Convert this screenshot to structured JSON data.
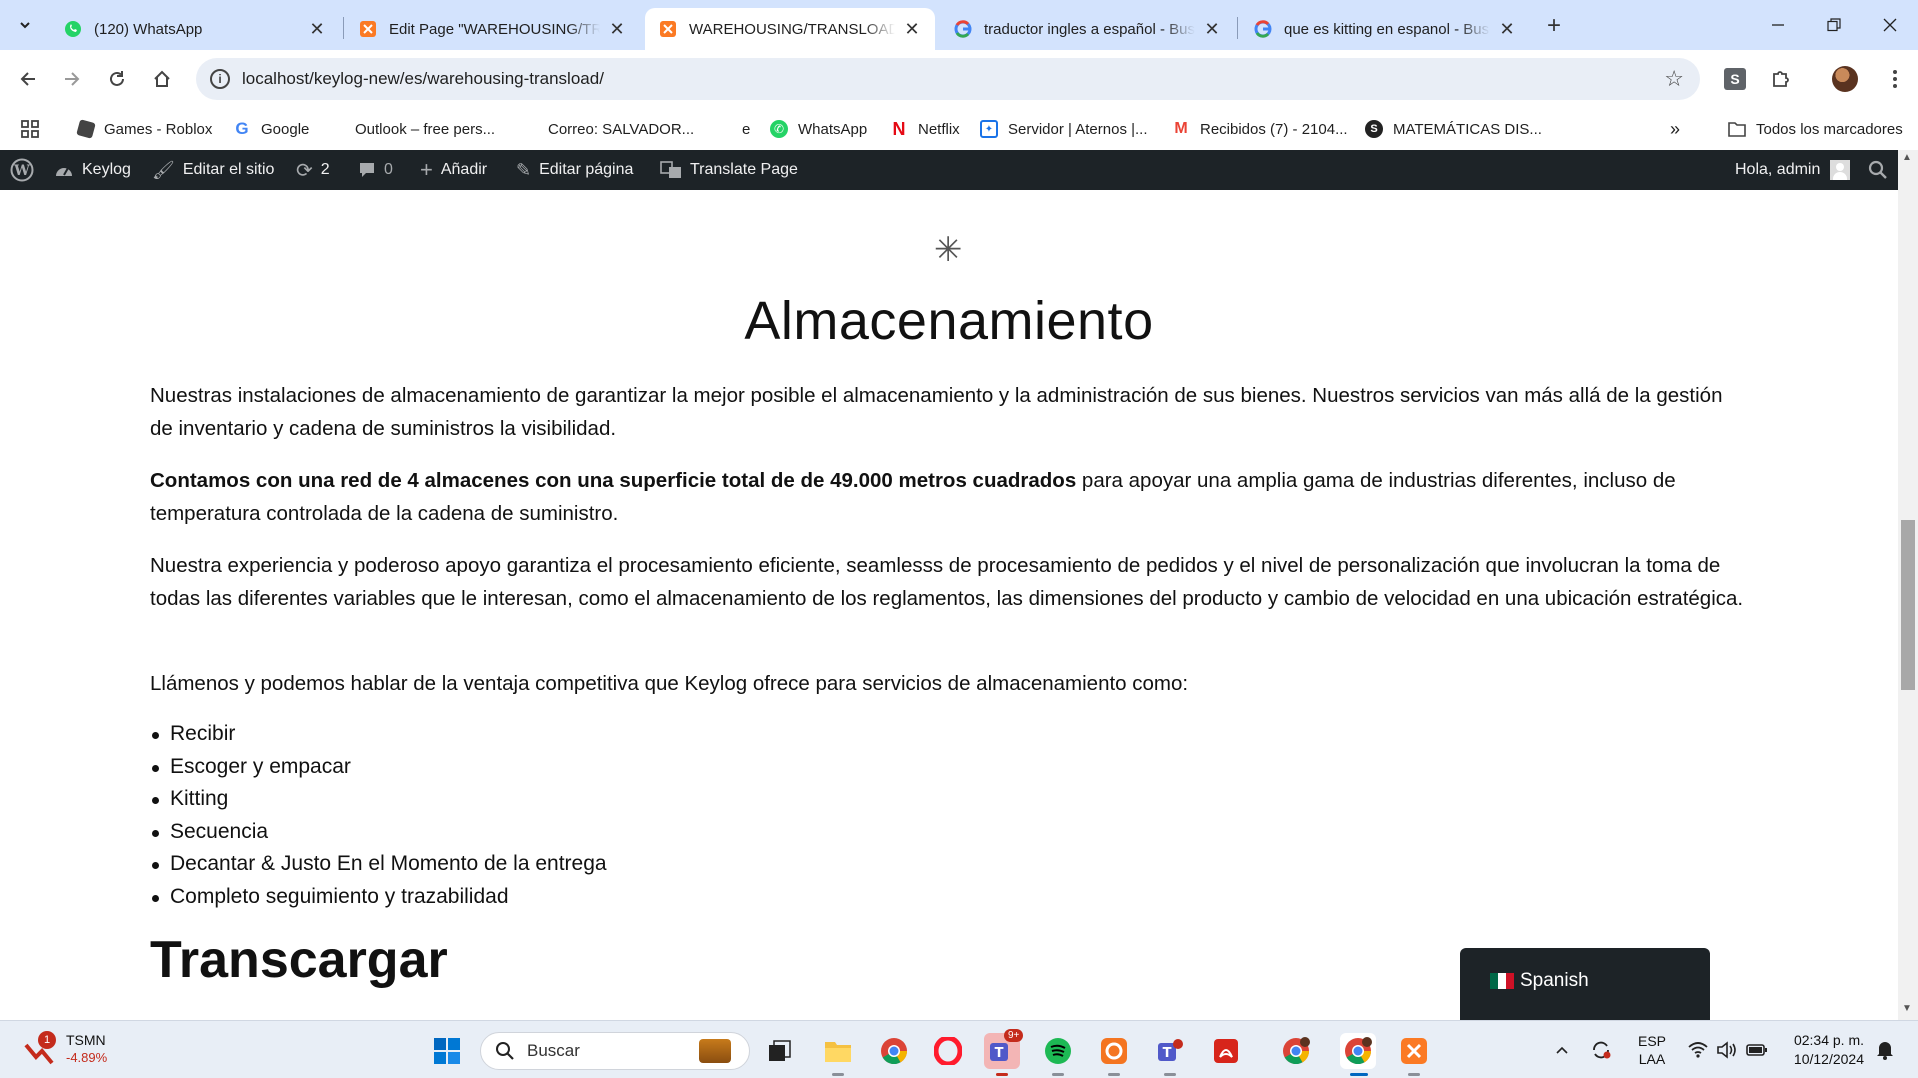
{
  "browser": {
    "tabs": [
      {
        "title": "(120) WhatsApp",
        "icon": "whatsapp-icon"
      },
      {
        "title": "Edit Page \"WAREHOUSING/TRA",
        "icon": "xampp-icon"
      },
      {
        "title": "WAREHOUSING/TRANSLOAD -",
        "icon": "xampp-icon",
        "active": true
      },
      {
        "title": "traductor ingles a español - Bus",
        "icon": "google-icon"
      },
      {
        "title": "que es kitting en espanol - Busc",
        "icon": "google-icon"
      }
    ],
    "url": "localhost/keylog-new/es/warehousing-transload/",
    "bookmarks": [
      "Games - Roblox",
      "Google",
      "Outlook – free pers...",
      "Correo: SALVADOR...",
      "e",
      "WhatsApp",
      "Netflix",
      "Servidor | Aternos |...",
      "Recibidos (7) - 2104...",
      "MATEMÁTICAS DIS..."
    ],
    "all_bookmarks": "Todos los marcadores"
  },
  "adminbar": {
    "site_name": "Keylog",
    "edit_site": "Editar el sitio",
    "updates_count": "2",
    "comments_count": "0",
    "add_new": "Añadir",
    "edit_page": "Editar página",
    "translate": "Translate Page",
    "greeting": "Hola, admin"
  },
  "page": {
    "asterisk": "✳",
    "heading": "Almacenamiento",
    "p1": "Nuestras instalaciones de almacenamiento de garantizar la mejor posible el almacenamiento y la administración de sus bienes. Nuestros servicios van más allá de la gestión de inventario y cadena de suministros la visibilidad.",
    "p2_bold": "Contamos con una red de 4 almacenes con una superficie total de de 49.000 metros cuadrados",
    "p2_rest": " para apoyar una amplia gama de industrias diferentes, incluso de temperatura controlada de la cadena de suministro.",
    "p3": "Nuestra experiencia y poderoso apoyo garantiza el procesamiento eficiente, seamlesss de procesamiento de pedidos y el nivel de personalización que involucran la toma de todas las diferentes variables que le interesan, como el almacenamiento de los reglamentos, las dimensiones del producto y cambio de velocidad en una ubicación estratégica.",
    "p4": "Llámenos y podemos hablar de la ventaja competitiva que Keylog ofrece para servicios de almacenamiento como:",
    "services": [
      "Recibir",
      "Escoger y empacar",
      "Kitting",
      "Secuencia",
      "Decantar & Justo En el Momento de la entrega",
      "Completo seguimiento y trazabilidad"
    ],
    "subheading": "Transcargar",
    "language_widget": "Spanish"
  },
  "taskbar": {
    "stock_name": "TSMN",
    "stock_change": "-4.89%",
    "stock_badge": "1",
    "search_placeholder": "Buscar",
    "teams_badge": "9+",
    "lang_top": "ESP",
    "lang_bottom": "LAA",
    "time": "02:34 p. m.",
    "date": "10/12/2024"
  }
}
